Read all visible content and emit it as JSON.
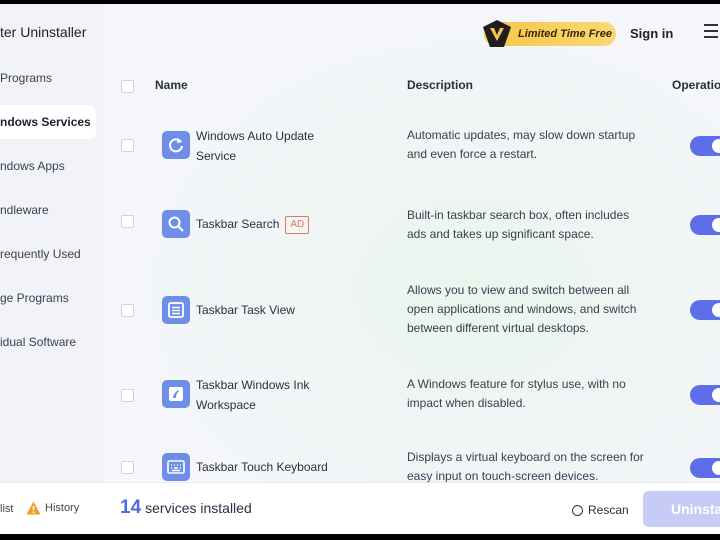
{
  "app": {
    "title": "ter Uninstaller"
  },
  "sidebar": {
    "items": [
      {
        "label": "Programs",
        "active": false
      },
      {
        "label": "ndows Services",
        "active": true
      },
      {
        "label": "ndows Apps",
        "active": false
      },
      {
        "label": "ndleware",
        "active": false
      },
      {
        "label": "requently Used",
        "active": false
      },
      {
        "label": "ge Programs",
        "active": false
      },
      {
        "label": "idual Software",
        "active": false
      }
    ]
  },
  "topbar": {
    "badge_label": "Limited Time Free",
    "signin_label": "Sign in"
  },
  "table": {
    "headers": {
      "name": "Name",
      "description": "Description",
      "operation": "Operatio"
    },
    "rows": [
      {
        "name": "Windows Auto Update Service",
        "description": "Automatic updates, may slow down startup and even force a restart.",
        "icon": "refresh-icon",
        "ad": "",
        "enabled": true
      },
      {
        "name": "Taskbar Search",
        "description": "Built-in taskbar search box, often includes ads and takes up significant space.",
        "icon": "search-icon",
        "ad": "AD",
        "enabled": true
      },
      {
        "name": "Taskbar Task View",
        "description": "Allows you to view and switch between all open applications and windows, and switch between different virtual desktops.",
        "icon": "task-view-icon",
        "ad": "",
        "enabled": true
      },
      {
        "name": "Taskbar Windows Ink Workspace",
        "description": "A Windows feature for stylus use, with no impact when disabled.",
        "icon": "ink-icon",
        "ad": "",
        "enabled": true
      },
      {
        "name": "Taskbar Touch Keyboard",
        "description": "Displays a virtual keyboard on the screen for easy input on touch-screen devices.",
        "icon": "keyboard-icon",
        "ad": "",
        "enabled": true
      }
    ]
  },
  "footer": {
    "list_label": "list",
    "history_label": "History",
    "count": "14",
    "count_suffix": "services installed",
    "rescan_label": "Rescan",
    "uninstall_label": "Uninstall"
  },
  "colors": {
    "accent": "#5d6ee8",
    "badge": "#f5c64a",
    "ad_tag": "#e07a55"
  }
}
